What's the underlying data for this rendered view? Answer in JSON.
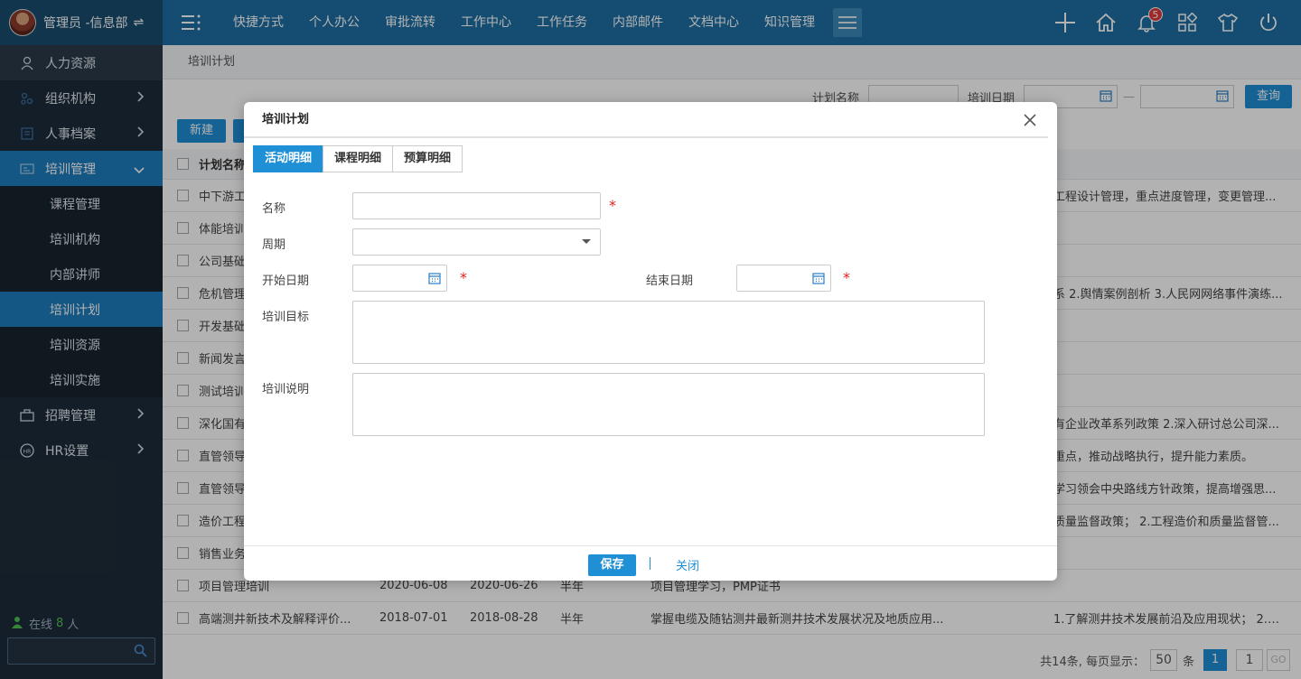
{
  "user": {
    "name": "管理员 -信息部"
  },
  "nav": [
    "快捷方式",
    "个人办公",
    "审批流转",
    "工作中心",
    "工作任务",
    "内部邮件",
    "文档中心",
    "知识管理"
  ],
  "notifications": {
    "count": "5"
  },
  "sidebar": {
    "items": [
      {
        "label": "人力资源"
      },
      {
        "label": "组织机构"
      },
      {
        "label": "人事档案"
      },
      {
        "label": "培训管理"
      },
      {
        "label": "招聘管理"
      },
      {
        "label": "HR设置"
      }
    ],
    "sub_items": [
      "课程管理",
      "培训机构",
      "内部讲师",
      "培训计划",
      "培训资源",
      "培训实施"
    ],
    "online_label": "在线",
    "online_count": "8",
    "online_unit": "人"
  },
  "breadcrumb": "培训计划",
  "filter": {
    "name_label": "计划名称",
    "date_label": "培训日期",
    "query_button": "查询",
    "separator": "—"
  },
  "toolbar": {
    "new_button": "新建"
  },
  "table": {
    "header": "计划名称",
    "rows": [
      {
        "name": "中下游工",
        "right": "工程设计管理，重点进度管理，变更管理..."
      },
      {
        "name": "体能培训",
        "right": ""
      },
      {
        "name": "公司基础",
        "right": ""
      },
      {
        "name": "危机管理",
        "right": "系 2.舆情案例剖析 3.人民网网络事件演练..."
      },
      {
        "name": "开发基础",
        "right": ""
      },
      {
        "name": "新闻发言",
        "right": ""
      },
      {
        "name": "测试培训",
        "right": ""
      },
      {
        "name": "深化国有",
        "right": "有企业改革系列政策 2.深入研讨总公司深..."
      },
      {
        "name": "直管领导",
        "right": "重点，推动战略执行，提升能力素质。"
      },
      {
        "name": "直管领导",
        "right": "学习领会中央路线方针政策，提高增强思..."
      },
      {
        "name": "造价工程",
        "right": "质量监督政策； 2.工程造价和质量监督管..."
      },
      {
        "name": "销售业务",
        "right": ""
      },
      {
        "name": "项目管理培训",
        "start": "2020-06-08",
        "end": "2020-06-26",
        "cycle": "半年",
        "goal": "项目管理学习，PMP证书",
        "right": ""
      },
      {
        "name": "高端测井新技术及解释评价...",
        "start": "2018-07-01",
        "end": "2018-08-28",
        "cycle": "半年",
        "goal": "掌握电缆及随钻测井最新测井技术发展状况及地质应用...",
        "right": "1.了解测井技术发展前沿及应用现状； 2.掌握电缆测井..."
      }
    ]
  },
  "pager": {
    "total_text": "共14条, 每页显示：",
    "page_size": "50",
    "unit": "条",
    "current": "1",
    "input": "1",
    "go": "GO"
  },
  "modal": {
    "title": "培训计划",
    "tabs": [
      "活动明细",
      "课程明细",
      "预算明细"
    ],
    "fields": {
      "name": "名称",
      "cycle": "周期",
      "start_date": "开始日期",
      "end_date": "结束日期",
      "goal": "培训目标",
      "description": "培训说明"
    },
    "required_mark": "*",
    "save_button": "保存",
    "close_button": "关闭"
  }
}
